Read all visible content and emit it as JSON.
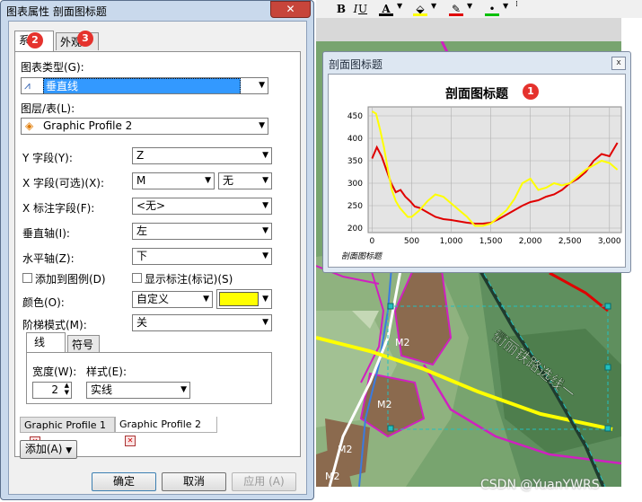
{
  "dialog": {
    "title": "图表属性 剖面图标题",
    "close_label": "✕",
    "tabs": [
      {
        "label": "系",
        "badge": "2"
      },
      {
        "label": "外观",
        "badge": "3"
      }
    ],
    "chart_type": {
      "label": "图表类型(G):",
      "value": "垂直线"
    },
    "layer": {
      "label": "图层/表(L):",
      "value": "Graphic Profile 2"
    },
    "y_field": {
      "label": "Y 字段(Y):",
      "value": "Z"
    },
    "x_field": {
      "label": "X 字段(可选)(X):",
      "value": "M",
      "sort": "无"
    },
    "x_label_field": {
      "label": "X 标注字段(F):",
      "value": "<无>"
    },
    "vertical_axis": {
      "label": "垂直轴(I):",
      "value": "左"
    },
    "horizontal_axis": {
      "label": "水平轴(Z):",
      "value": "下"
    },
    "add_to_legend": "添加到图例(D)",
    "show_labels": "显示标注(标记)(S)",
    "color": {
      "label": "颜色(O):",
      "value": "自定义",
      "swatch": "#ffff00"
    },
    "step_mode": {
      "label": "阶梯模式(M):",
      "value": "关"
    },
    "sub_tabs": [
      "线",
      "符号"
    ],
    "width": {
      "label": "宽度(W):",
      "value": "2"
    },
    "style": {
      "label": "样式(E):",
      "value": "实线"
    },
    "layer_tabs": [
      "Graphic Profile 1",
      "Graphic Profile 2"
    ],
    "add_button": "添加(A)",
    "ok_button": "确定",
    "cancel_button": "取消",
    "apply_button": "应用 (A)"
  },
  "toolbar": {
    "bold": "B",
    "italic": "I",
    "underline": "U",
    "font_color_glyph": "A",
    "fill_icon": "fill-bucket-icon",
    "line_icon": "pen-icon",
    "colors": {
      "font": "#000000",
      "fill": "#ffff00",
      "line": "#e00000",
      "marker": "#00c000"
    }
  },
  "chart_window": {
    "title": "剖面图标题",
    "close_label": "x",
    "badge": "1"
  },
  "chart_data": {
    "type": "line",
    "title": "剖面图标题",
    "xlabel": "剖面图标题",
    "ylabel": "",
    "xlim": [
      -50,
      3150
    ],
    "ylim": [
      190,
      470
    ],
    "xticks": [
      0,
      500,
      1000,
      1500,
      2000,
      2500,
      3000
    ],
    "xtick_labels": [
      "0",
      "500",
      "1,000",
      "1,500",
      "2,000",
      "2,500",
      "3,000"
    ],
    "yticks": [
      200,
      250,
      300,
      350,
      400,
      450
    ],
    "grid": true,
    "series": [
      {
        "color": "#e00000",
        "x": [
          0,
          60,
          120,
          180,
          240,
          300,
          360,
          420,
          480,
          540,
          600,
          700,
          800,
          900,
          1000,
          1100,
          1200,
          1300,
          1400,
          1500,
          1600,
          1700,
          1800,
          1900,
          2000,
          2100,
          2200,
          2300,
          2400,
          2500,
          2600,
          2700,
          2800,
          2900,
          3000,
          3100
        ],
        "y": [
          355,
          380,
          360,
          330,
          300,
          280,
          285,
          270,
          260,
          248,
          245,
          235,
          225,
          220,
          218,
          215,
          212,
          210,
          210,
          212,
          220,
          230,
          240,
          250,
          258,
          262,
          270,
          275,
          285,
          300,
          310,
          325,
          350,
          365,
          360,
          390
        ]
      },
      {
        "color": "#ffff00",
        "x": [
          0,
          50,
          100,
          150,
          200,
          250,
          300,
          350,
          400,
          450,
          500,
          600,
          700,
          800,
          900,
          1000,
          1100,
          1200,
          1300,
          1400,
          1500,
          1600,
          1700,
          1800,
          1900,
          2000,
          2100,
          2200,
          2300,
          2400,
          2500,
          2600,
          2700,
          2800,
          2900,
          3000,
          3100
        ],
        "y": [
          460,
          455,
          420,
          380,
          330,
          285,
          260,
          245,
          235,
          225,
          225,
          240,
          260,
          275,
          270,
          255,
          240,
          225,
          205,
          205,
          210,
          225,
          240,
          265,
          300,
          310,
          285,
          290,
          300,
          295,
          300,
          315,
          330,
          340,
          350,
          345,
          330
        ]
      }
    ]
  },
  "map": {
    "railway_label": "衢丽铁路选线一",
    "zone_labels": [
      "M2",
      "M2",
      "M2",
      "M2"
    ]
  },
  "watermark": "CSDN @YuanYWRS"
}
